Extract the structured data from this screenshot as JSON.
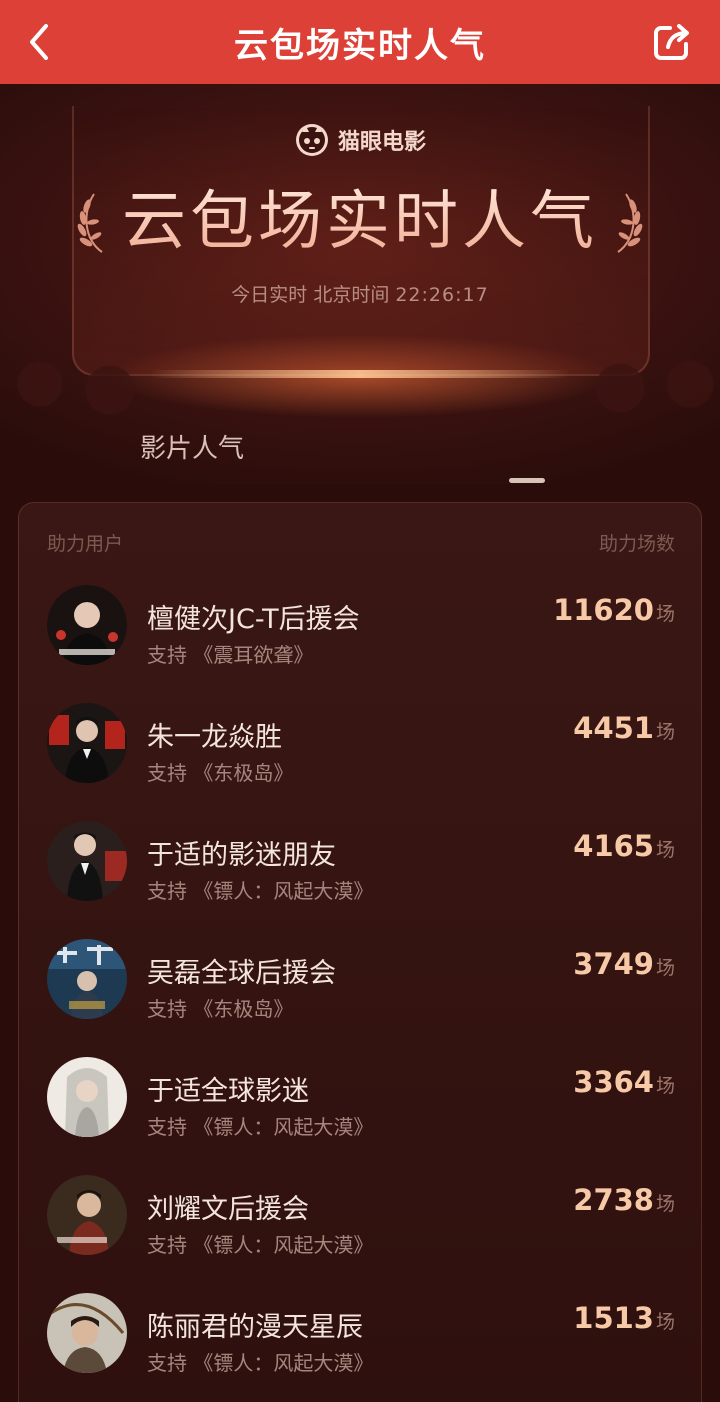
{
  "navbar": {
    "title": "云包场实时人气",
    "colors": {
      "background": "#dd4036"
    }
  },
  "hero": {
    "brand": "猫眼电影",
    "title": "云包场实时人气",
    "time_prefix": "今日实时 北京时间",
    "time": "22:26:17"
  },
  "tabs": {
    "active": "影片人气"
  },
  "ranking": {
    "header_left": "助力用户",
    "header_right": "助力场数",
    "unit": "场",
    "support_prefix": "支持",
    "items": [
      {
        "name": "檀健次JC-T后援会",
        "support": "《震耳欲聋》",
        "count": "11620"
      },
      {
        "name": "朱一龙焱胜",
        "support": "《东极岛》",
        "count": "4451"
      },
      {
        "name": "于适的影迷朋友",
        "support": "《镖人：风起大漠》",
        "count": "4165"
      },
      {
        "name": "吴磊全球后援会",
        "support": "《东极岛》",
        "count": "3749"
      },
      {
        "name": "于适全球影迷",
        "support": "《镖人：风起大漠》",
        "count": "3364"
      },
      {
        "name": "刘耀文后援会",
        "support": "《镖人：风起大漠》",
        "count": "2738"
      },
      {
        "name": "陈丽君的漫天星辰",
        "support": "《镖人：风起大漠》",
        "count": "1513"
      }
    ]
  }
}
